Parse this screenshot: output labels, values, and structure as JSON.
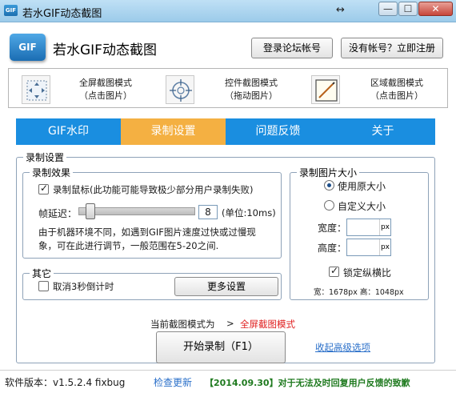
{
  "window": {
    "title": "若水GIF动态截图",
    "resize_glyph": "↔",
    "min_glyph": "—",
    "max_glyph": "☐",
    "close_glyph": "✕",
    "icon_text": "GIF"
  },
  "header": {
    "logo_text": "GIF",
    "app_name": "若水GIF动态截图",
    "login_label": "登录论坛帐号",
    "register_label": "没有帐号？立即注册"
  },
  "modes": [
    {
      "label": "全屏截图模式",
      "hint": "（点击图片）",
      "icon": "fullscreen-icon"
    },
    {
      "label": "控件截图模式",
      "hint": "（拖动图片）",
      "icon": "crosshair-icon"
    },
    {
      "label": "区域截图模式",
      "hint": "（点击图片）",
      "icon": "region-icon"
    }
  ],
  "tabs": [
    {
      "label": "GIF水印",
      "active": false
    },
    {
      "label": "录制设置",
      "active": true
    },
    {
      "label": "问题反馈",
      "active": false
    },
    {
      "label": "关于",
      "active": false
    }
  ],
  "settings": {
    "group_title": "录制设置",
    "effect": {
      "title": "录制效果",
      "record_mouse_label": "录制鼠标(此功能可能导致极少部分用户录制失败)",
      "record_mouse_checked": true,
      "delay_label": "帧延迟：",
      "delay_value": "8",
      "delay_unit": "(单位:10ms)",
      "note_line1": "由于机器环境不同，如遇到GIF图片速度过快或过慢现",
      "note_line2": "象，可在此进行调节，一般范围在5-20之间."
    },
    "other": {
      "title": "其它",
      "cancel_countdown_label": "取消3秒倒计时",
      "cancel_countdown_checked": false,
      "more_settings_label": "更多设置"
    },
    "size": {
      "title": "录制图片大小",
      "original_label": "使用原大小",
      "original_selected": true,
      "custom_label": "自定义大小",
      "width_label": "宽度：",
      "height_label": "高度：",
      "width_value": "",
      "height_value": "",
      "unit": "px",
      "lock_ratio_label": "锁定纵横比",
      "lock_ratio_checked": true,
      "dims_text": "宽：1678px 高：1048px"
    }
  },
  "current_mode": {
    "label": "当前截图模式为",
    "arrow": ">",
    "value": "全屏截图模式"
  },
  "start_button_label": "开始录制（F1）",
  "advanced_link_label": "收起高级选项",
  "footer": {
    "version_text": "软件版本：v1.5.2.4 fixbug",
    "check_update_label": "检查更新",
    "notice_text": "【2014.09.30】对于无法及时回复用户反馈的致歉"
  },
  "colors": {
    "tab_bar": "#1a8ee0",
    "tab_active": "#f4b042",
    "current_mode_value": "#e02020",
    "link": "#2a6fc9",
    "notice": "#1f7a1f"
  }
}
